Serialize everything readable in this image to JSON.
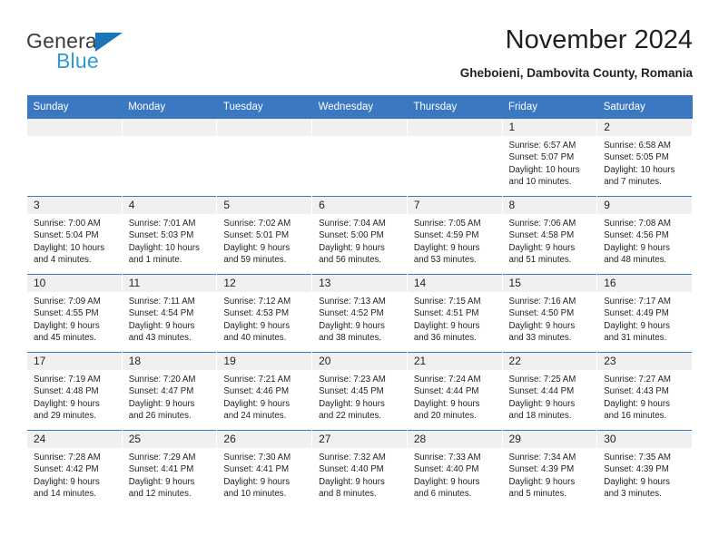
{
  "brand": {
    "name_line1": "General",
    "name_line2": "Blue",
    "triangle_icon": "blue-triangle-icon",
    "color_dark": "#3c3c3b",
    "color_blue": "#1b75bb",
    "color_light_blue": "#2e9ad6"
  },
  "header": {
    "title": "November 2024",
    "location": "Gheboieni, Dambovita County, Romania"
  },
  "theme": {
    "header_blue": "#3a78c2",
    "daynum_bg": "#f0f0f0",
    "text": "#231f20"
  },
  "weekdays": [
    "Sunday",
    "Monday",
    "Tuesday",
    "Wednesday",
    "Thursday",
    "Friday",
    "Saturday"
  ],
  "weeks": [
    [
      {
        "day": "",
        "sunrise": "",
        "sunset": "",
        "daylight_line1": "",
        "daylight_line2": ""
      },
      {
        "day": "",
        "sunrise": "",
        "sunset": "",
        "daylight_line1": "",
        "daylight_line2": ""
      },
      {
        "day": "",
        "sunrise": "",
        "sunset": "",
        "daylight_line1": "",
        "daylight_line2": ""
      },
      {
        "day": "",
        "sunrise": "",
        "sunset": "",
        "daylight_line1": "",
        "daylight_line2": ""
      },
      {
        "day": "",
        "sunrise": "",
        "sunset": "",
        "daylight_line1": "",
        "daylight_line2": ""
      },
      {
        "day": "1",
        "sunrise": "Sunrise: 6:57 AM",
        "sunset": "Sunset: 5:07 PM",
        "daylight_line1": "Daylight: 10 hours",
        "daylight_line2": "and 10 minutes."
      },
      {
        "day": "2",
        "sunrise": "Sunrise: 6:58 AM",
        "sunset": "Sunset: 5:05 PM",
        "daylight_line1": "Daylight: 10 hours",
        "daylight_line2": "and 7 minutes."
      }
    ],
    [
      {
        "day": "3",
        "sunrise": "Sunrise: 7:00 AM",
        "sunset": "Sunset: 5:04 PM",
        "daylight_line1": "Daylight: 10 hours",
        "daylight_line2": "and 4 minutes."
      },
      {
        "day": "4",
        "sunrise": "Sunrise: 7:01 AM",
        "sunset": "Sunset: 5:03 PM",
        "daylight_line1": "Daylight: 10 hours",
        "daylight_line2": "and 1 minute."
      },
      {
        "day": "5",
        "sunrise": "Sunrise: 7:02 AM",
        "sunset": "Sunset: 5:01 PM",
        "daylight_line1": "Daylight: 9 hours",
        "daylight_line2": "and 59 minutes."
      },
      {
        "day": "6",
        "sunrise": "Sunrise: 7:04 AM",
        "sunset": "Sunset: 5:00 PM",
        "daylight_line1": "Daylight: 9 hours",
        "daylight_line2": "and 56 minutes."
      },
      {
        "day": "7",
        "sunrise": "Sunrise: 7:05 AM",
        "sunset": "Sunset: 4:59 PM",
        "daylight_line1": "Daylight: 9 hours",
        "daylight_line2": "and 53 minutes."
      },
      {
        "day": "8",
        "sunrise": "Sunrise: 7:06 AM",
        "sunset": "Sunset: 4:58 PM",
        "daylight_line1": "Daylight: 9 hours",
        "daylight_line2": "and 51 minutes."
      },
      {
        "day": "9",
        "sunrise": "Sunrise: 7:08 AM",
        "sunset": "Sunset: 4:56 PM",
        "daylight_line1": "Daylight: 9 hours",
        "daylight_line2": "and 48 minutes."
      }
    ],
    [
      {
        "day": "10",
        "sunrise": "Sunrise: 7:09 AM",
        "sunset": "Sunset: 4:55 PM",
        "daylight_line1": "Daylight: 9 hours",
        "daylight_line2": "and 45 minutes."
      },
      {
        "day": "11",
        "sunrise": "Sunrise: 7:11 AM",
        "sunset": "Sunset: 4:54 PM",
        "daylight_line1": "Daylight: 9 hours",
        "daylight_line2": "and 43 minutes."
      },
      {
        "day": "12",
        "sunrise": "Sunrise: 7:12 AM",
        "sunset": "Sunset: 4:53 PM",
        "daylight_line1": "Daylight: 9 hours",
        "daylight_line2": "and 40 minutes."
      },
      {
        "day": "13",
        "sunrise": "Sunrise: 7:13 AM",
        "sunset": "Sunset: 4:52 PM",
        "daylight_line1": "Daylight: 9 hours",
        "daylight_line2": "and 38 minutes."
      },
      {
        "day": "14",
        "sunrise": "Sunrise: 7:15 AM",
        "sunset": "Sunset: 4:51 PM",
        "daylight_line1": "Daylight: 9 hours",
        "daylight_line2": "and 36 minutes."
      },
      {
        "day": "15",
        "sunrise": "Sunrise: 7:16 AM",
        "sunset": "Sunset: 4:50 PM",
        "daylight_line1": "Daylight: 9 hours",
        "daylight_line2": "and 33 minutes."
      },
      {
        "day": "16",
        "sunrise": "Sunrise: 7:17 AM",
        "sunset": "Sunset: 4:49 PM",
        "daylight_line1": "Daylight: 9 hours",
        "daylight_line2": "and 31 minutes."
      }
    ],
    [
      {
        "day": "17",
        "sunrise": "Sunrise: 7:19 AM",
        "sunset": "Sunset: 4:48 PM",
        "daylight_line1": "Daylight: 9 hours",
        "daylight_line2": "and 29 minutes."
      },
      {
        "day": "18",
        "sunrise": "Sunrise: 7:20 AM",
        "sunset": "Sunset: 4:47 PM",
        "daylight_line1": "Daylight: 9 hours",
        "daylight_line2": "and 26 minutes."
      },
      {
        "day": "19",
        "sunrise": "Sunrise: 7:21 AM",
        "sunset": "Sunset: 4:46 PM",
        "daylight_line1": "Daylight: 9 hours",
        "daylight_line2": "and 24 minutes."
      },
      {
        "day": "20",
        "sunrise": "Sunrise: 7:23 AM",
        "sunset": "Sunset: 4:45 PM",
        "daylight_line1": "Daylight: 9 hours",
        "daylight_line2": "and 22 minutes."
      },
      {
        "day": "21",
        "sunrise": "Sunrise: 7:24 AM",
        "sunset": "Sunset: 4:44 PM",
        "daylight_line1": "Daylight: 9 hours",
        "daylight_line2": "and 20 minutes."
      },
      {
        "day": "22",
        "sunrise": "Sunrise: 7:25 AM",
        "sunset": "Sunset: 4:44 PM",
        "daylight_line1": "Daylight: 9 hours",
        "daylight_line2": "and 18 minutes."
      },
      {
        "day": "23",
        "sunrise": "Sunrise: 7:27 AM",
        "sunset": "Sunset: 4:43 PM",
        "daylight_line1": "Daylight: 9 hours",
        "daylight_line2": "and 16 minutes."
      }
    ],
    [
      {
        "day": "24",
        "sunrise": "Sunrise: 7:28 AM",
        "sunset": "Sunset: 4:42 PM",
        "daylight_line1": "Daylight: 9 hours",
        "daylight_line2": "and 14 minutes."
      },
      {
        "day": "25",
        "sunrise": "Sunrise: 7:29 AM",
        "sunset": "Sunset: 4:41 PM",
        "daylight_line1": "Daylight: 9 hours",
        "daylight_line2": "and 12 minutes."
      },
      {
        "day": "26",
        "sunrise": "Sunrise: 7:30 AM",
        "sunset": "Sunset: 4:41 PM",
        "daylight_line1": "Daylight: 9 hours",
        "daylight_line2": "and 10 minutes."
      },
      {
        "day": "27",
        "sunrise": "Sunrise: 7:32 AM",
        "sunset": "Sunset: 4:40 PM",
        "daylight_line1": "Daylight: 9 hours",
        "daylight_line2": "and 8 minutes."
      },
      {
        "day": "28",
        "sunrise": "Sunrise: 7:33 AM",
        "sunset": "Sunset: 4:40 PM",
        "daylight_line1": "Daylight: 9 hours",
        "daylight_line2": "and 6 minutes."
      },
      {
        "day": "29",
        "sunrise": "Sunrise: 7:34 AM",
        "sunset": "Sunset: 4:39 PM",
        "daylight_line1": "Daylight: 9 hours",
        "daylight_line2": "and 5 minutes."
      },
      {
        "day": "30",
        "sunrise": "Sunrise: 7:35 AM",
        "sunset": "Sunset: 4:39 PM",
        "daylight_line1": "Daylight: 9 hours",
        "daylight_line2": "and 3 minutes."
      }
    ]
  ]
}
